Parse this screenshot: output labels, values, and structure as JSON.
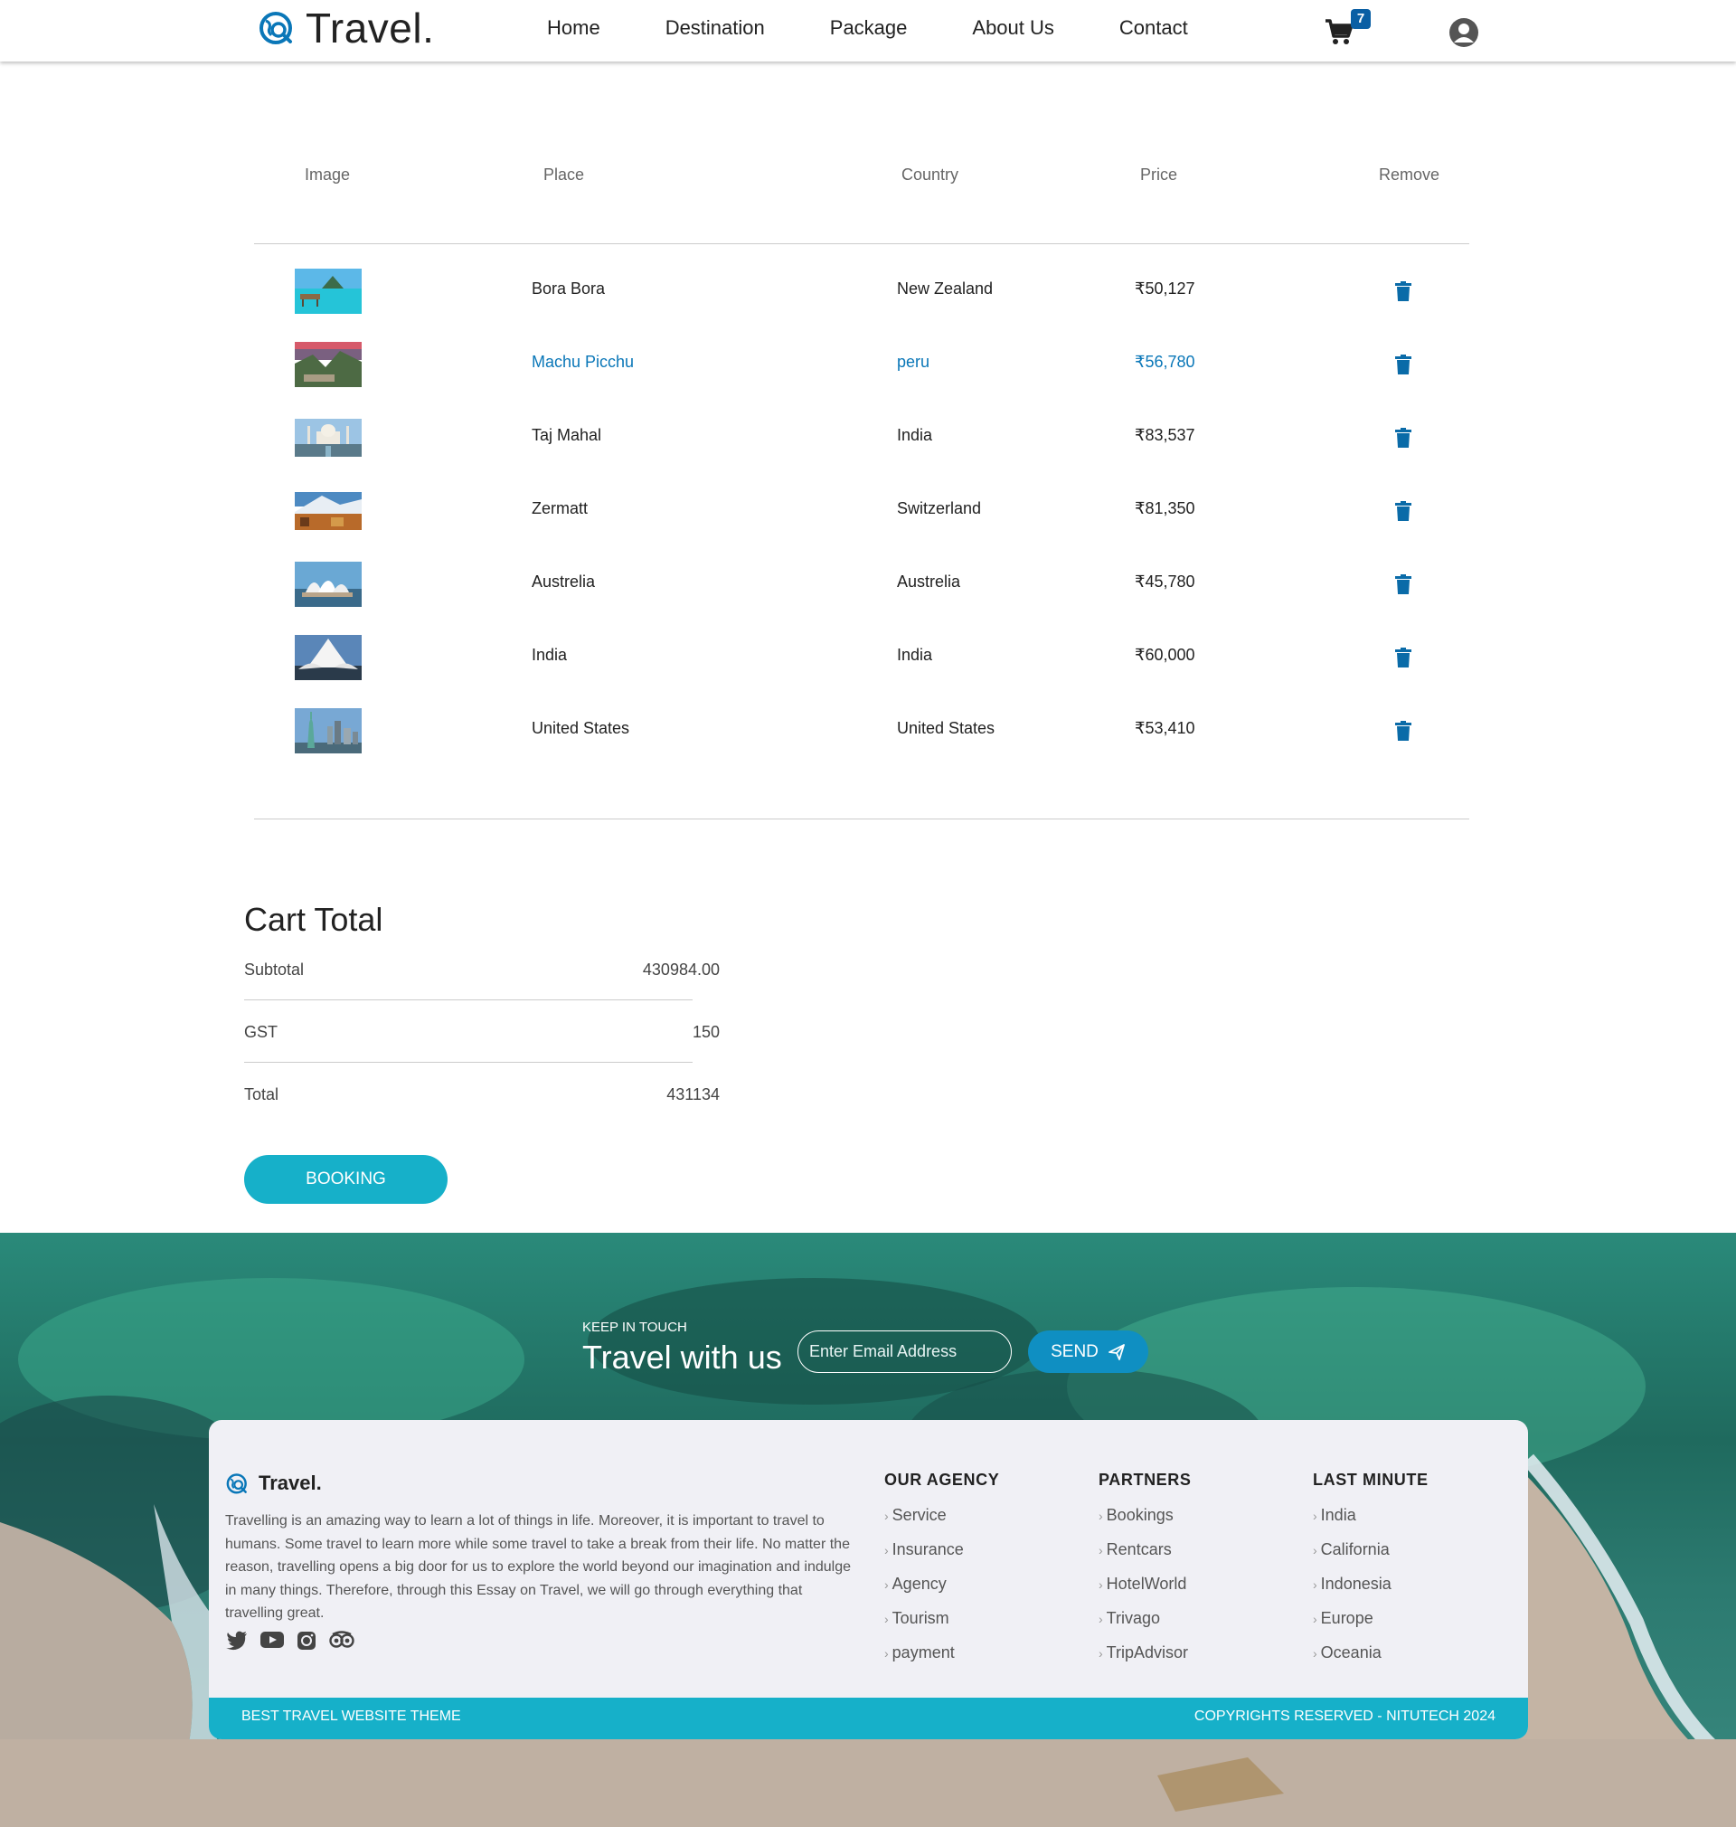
{
  "header": {
    "logo_text": "Travel.",
    "nav": [
      "Home",
      "Destination",
      "Package",
      "About Us",
      "Contact"
    ],
    "cart_count": "7"
  },
  "table": {
    "headers": [
      "Image",
      "Place",
      "Country",
      "Price",
      "Remove"
    ],
    "rows": [
      {
        "place": "Bora Bora",
        "country": "New Zealand",
        "price": "₹50,127",
        "image": "bora-bora-photo"
      },
      {
        "place": "Machu Picchu",
        "country": "peru",
        "price": "₹56,780",
        "image": "machu-picchu-photo"
      },
      {
        "place": "Taj Mahal",
        "country": "India",
        "price": "₹83,537",
        "image": "taj-mahal-photo"
      },
      {
        "place": "Zermatt",
        "country": "Switzerland",
        "price": "₹81,350",
        "image": "zermatt-photo"
      },
      {
        "place": "Austrelia",
        "country": "Austrelia",
        "price": "₹45,780",
        "image": "sydney-opera-photo"
      },
      {
        "place": "India",
        "country": "India",
        "price": "₹60,000",
        "image": "lotus-temple-photo"
      },
      {
        "place": "United States",
        "country": "United States",
        "price": "₹53,410",
        "image": "statue-of-liberty-photo"
      }
    ]
  },
  "cart_total": {
    "title": "Cart Total",
    "subtotal_label": "Subtotal",
    "subtotal_value": "430984.00",
    "gst_label": "GST",
    "gst_value": "150",
    "total_label": "Total",
    "total_value": "431134",
    "booking_label": "BOOKING"
  },
  "newsletter": {
    "eyebrow": "KEEP IN TOUCH",
    "title": "Travel with us",
    "email_placeholder": "Enter Email Address",
    "send_label": "SEND"
  },
  "footer": {
    "logo_text": "Travel.",
    "about": "Travelling is an amazing way to learn a lot of things in life. Moreover, it is important to travel to humans. Some travel to learn more while some travel to take a break from their life. No matter the reason, travelling opens a big door for us to explore the world beyond our imagination and indulge in many things. Therefore, through this Essay on Travel, we will go through everything that travelling great.",
    "columns": [
      {
        "title": "OUR AGENCY",
        "items": [
          "Service",
          "Insurance",
          "Agency",
          "Tourism",
          "payment"
        ]
      },
      {
        "title": "PARTNERS",
        "items": [
          "Bookings",
          "Rentcars",
          "HotelWorld",
          "Trivago",
          "TripAdvisor"
        ]
      },
      {
        "title": "LAST MINUTE",
        "items": [
          "India",
          "California",
          "Indonesia",
          "Europe",
          "Oceania"
        ]
      }
    ],
    "bar_left": "BEST TRAVEL WEBSITE THEME",
    "bar_right": "COPYRIGHTS RESERVED - NITUTECH 2024"
  },
  "colors": {
    "accent": "#16b0c9",
    "link_blue": "#0a77b8",
    "badge": "#0a5fa4"
  }
}
